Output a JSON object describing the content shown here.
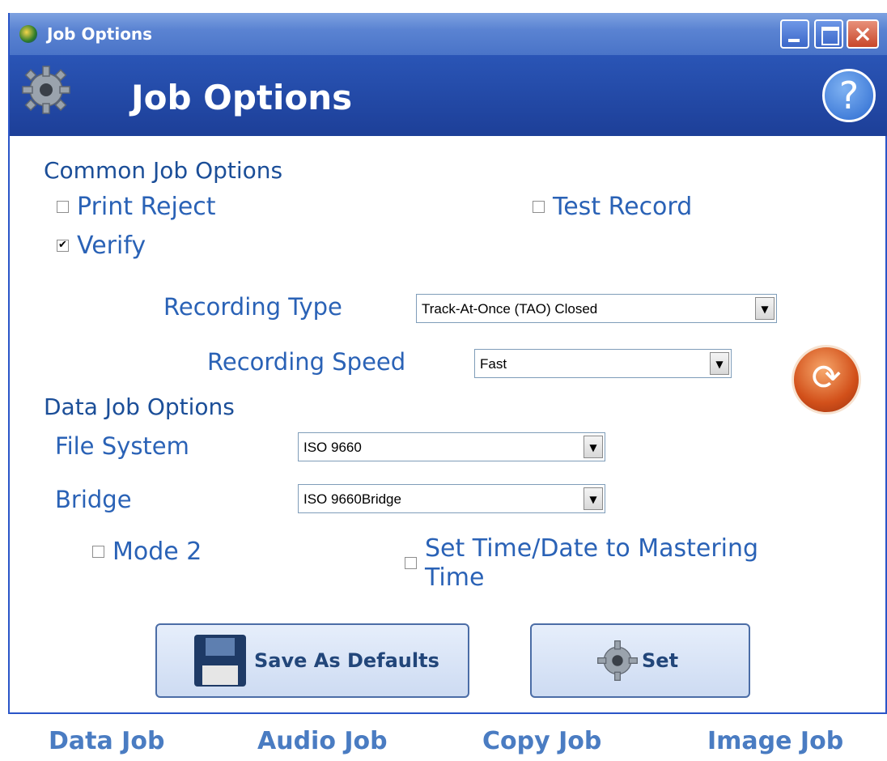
{
  "window": {
    "title": "Job Options",
    "header_title": "Job Options",
    "help_glyph": "?",
    "accent_color": "#1d3f98"
  },
  "common": {
    "section_title": "Common Job Options",
    "print_reject": {
      "label": "Print Reject",
      "checked": false
    },
    "test_record": {
      "label": "Test Record",
      "checked": false
    },
    "verify": {
      "label": "Verify",
      "checked": true
    },
    "recording_type_label": "Recording Type",
    "recording_type_value": "Track-At-Once (TAO) Closed",
    "recording_speed_label": "Recording Speed",
    "recording_speed_value": "Fast"
  },
  "data": {
    "section_title": "Data Job Options",
    "file_system_label": "File System",
    "file_system_value": "ISO 9660",
    "bridge_label": "Bridge",
    "bridge_value": "ISO 9660Bridge",
    "mode2": {
      "label": "Mode 2",
      "checked": false
    },
    "set_time": {
      "label_line1": "Set Time/Date to Mastering",
      "label_line2": "Time",
      "checked": false
    }
  },
  "buttons": {
    "save_defaults": "Save As Defaults",
    "set": "Set"
  },
  "tabs": [
    "Data Job",
    "Audio Job",
    "Copy Job",
    "Image Job"
  ],
  "icons": {
    "checked_glyph": "✔",
    "dropdown_glyph": "▼",
    "refresh_glyph": "⟳"
  }
}
